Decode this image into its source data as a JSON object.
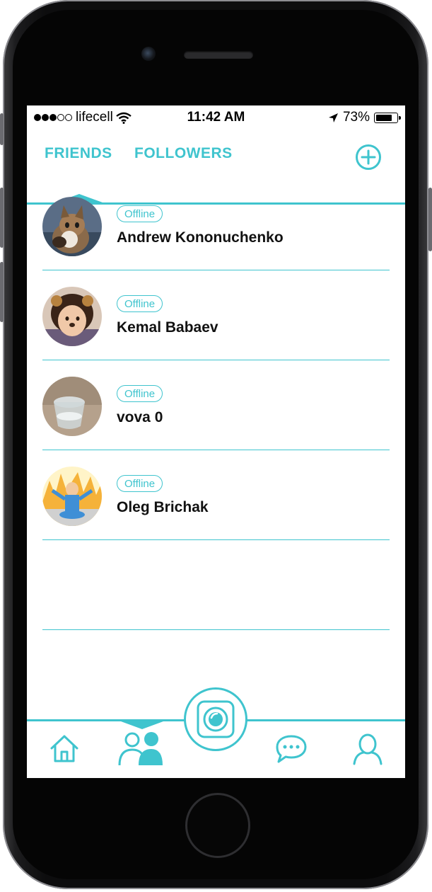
{
  "status_bar": {
    "carrier": "lifecell",
    "time": "11:42 AM",
    "battery": "73%"
  },
  "tabs": [
    {
      "label": "FRIENDS",
      "active": true
    },
    {
      "label": "FOLLOWERS",
      "active": false
    }
  ],
  "friends": [
    {
      "status": "Offline",
      "name": "Andrew Kononuchenko"
    },
    {
      "status": "Offline",
      "name": "Kemal Babaev"
    },
    {
      "status": "Offline",
      "name": "vova 0"
    },
    {
      "status": "Offline",
      "name": "Oleg Brichak"
    }
  ],
  "icons": {
    "add": "plus-circle-icon",
    "home": "home-icon",
    "friends": "friends-icon",
    "camera": "camera-icon",
    "chat": "chat-icon",
    "profile": "profile-icon"
  },
  "colors": {
    "accent": "#3fc4ce",
    "text": "#111111",
    "background": "#ffffff"
  }
}
